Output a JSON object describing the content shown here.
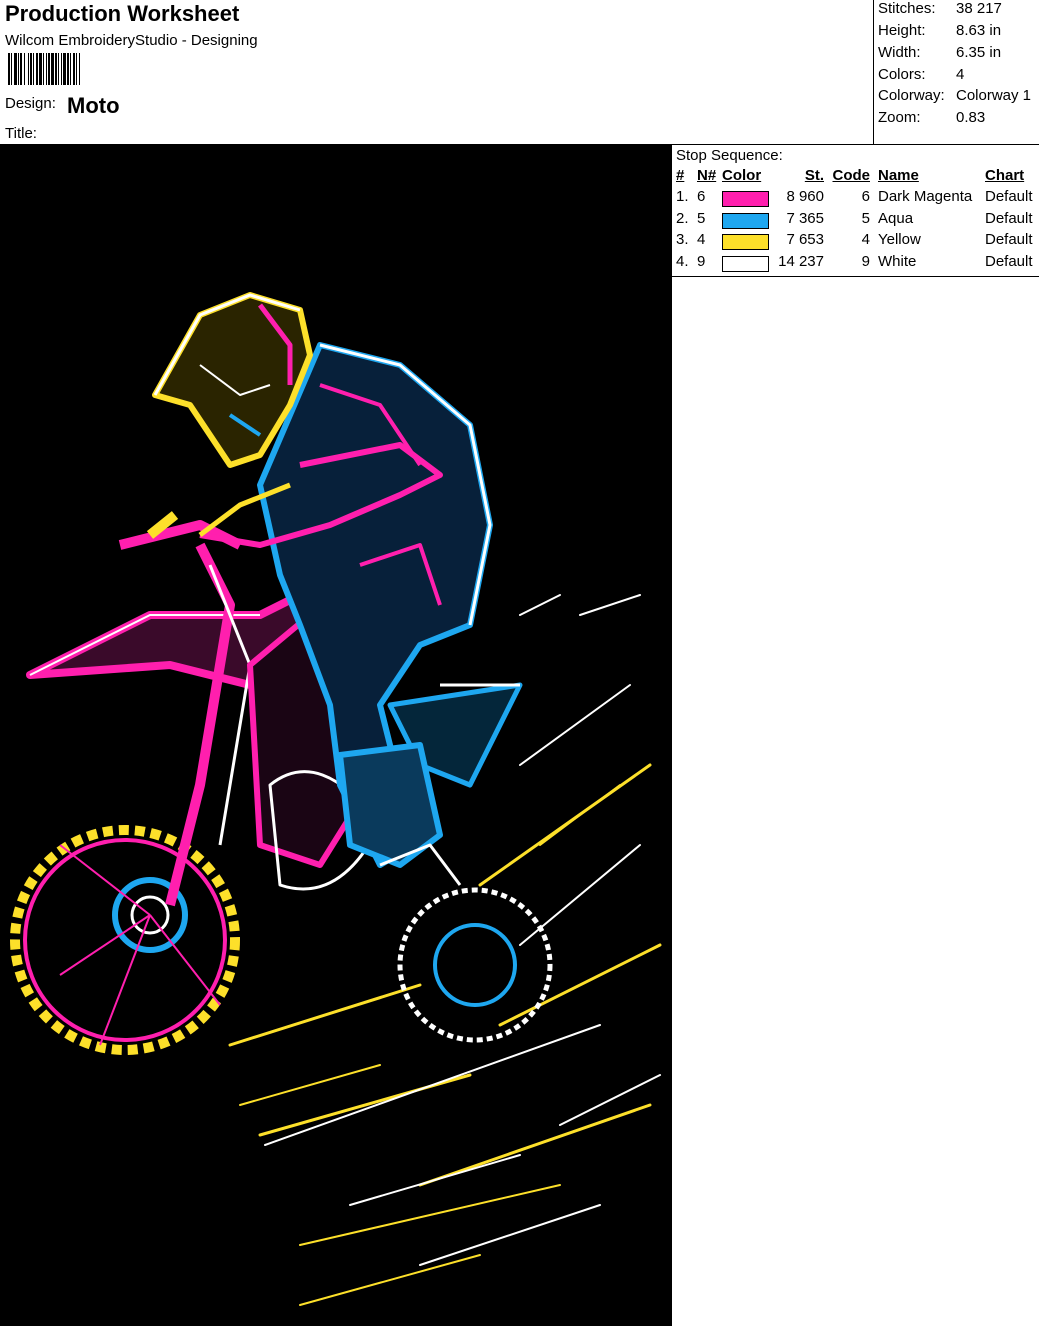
{
  "header": {
    "title": "Production Worksheet",
    "subtitle": "Wilcom EmbroideryStudio - Designing",
    "barcode_icon": "barcode-icon",
    "design_label": "Design:",
    "design_value": "Moto",
    "title_label": "Title:"
  },
  "stats": [
    {
      "label": "Stitches:",
      "value": "38 217"
    },
    {
      "label": "Height:",
      "value": "8.63 in"
    },
    {
      "label": "Width:",
      "value": "6.35 in"
    },
    {
      "label": "Colors:",
      "value": "4"
    },
    {
      "label": "Colorway:",
      "value": "Colorway 1"
    },
    {
      "label": "Zoom:",
      "value": "0.83"
    }
  ],
  "stop_sequence": {
    "title": "Stop Sequence:",
    "headers": {
      "num": "#",
      "n": "N#",
      "color": "Color",
      "st": "St.",
      "code": "Code",
      "name": "Name",
      "chart": "Chart"
    },
    "rows": [
      {
        "num": "1.",
        "n": "6",
        "swatch": "#ff1fae",
        "st": "8 960",
        "code": "6",
        "name": "Dark Magenta",
        "chart": "Default"
      },
      {
        "num": "2.",
        "n": "5",
        "swatch": "#1ea7f0",
        "st": "7 365",
        "code": "5",
        "name": "Aqua",
        "chart": "Default"
      },
      {
        "num": "3.",
        "n": "4",
        "swatch": "#fde02a",
        "st": "7 653",
        "code": "4",
        "name": "Yellow",
        "chart": "Default"
      },
      {
        "num": "4.",
        "n": "9",
        "swatch": "#ffffff",
        "st": "14 237",
        "code": "9",
        "name": "White",
        "chart": "Default"
      }
    ]
  },
  "design_preview": {
    "background": "#000000",
    "icon": "motocross-rider-embroidery-illustration"
  }
}
